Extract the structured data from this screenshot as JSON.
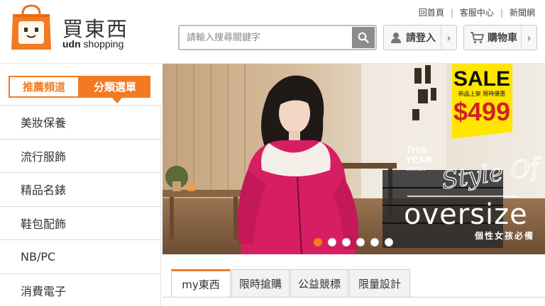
{
  "header": {
    "logo_cn": "買東西",
    "logo_en_bold": "udn",
    "logo_en_rest": "shopping",
    "top_links": [
      "回首頁",
      "客服中心",
      "新聞網"
    ],
    "search_placeholder": "請輸入搜尋關鍵字",
    "login_label": "請登入",
    "cart_label": "購物車"
  },
  "sidebar": {
    "tab_recommended": "推薦頻道",
    "tab_categories": "分類選單",
    "categories": [
      "美妝保養",
      "流行服飾",
      "精品名錶",
      "鞋包配飾",
      "NB/PC",
      "消費電子"
    ]
  },
  "banner": {
    "sale_title": "SALE",
    "sale_sub": "新品上架 限時優惠",
    "sale_price": "$499",
    "this_year": "THIS",
    "year": "YEAR",
    "winter": "WINTER",
    "style_of": "Style Of",
    "headline": "oversize",
    "tagline": "個性女孩必備",
    "slide_count": 6,
    "active_slide": 1
  },
  "bottom_tabs": [
    "my東西",
    "限時搶購",
    "公益競標",
    "限量設計"
  ],
  "colors": {
    "accent": "#f37a21",
    "sale_yellow": "#ffe500",
    "sale_red": "#d21f26"
  }
}
